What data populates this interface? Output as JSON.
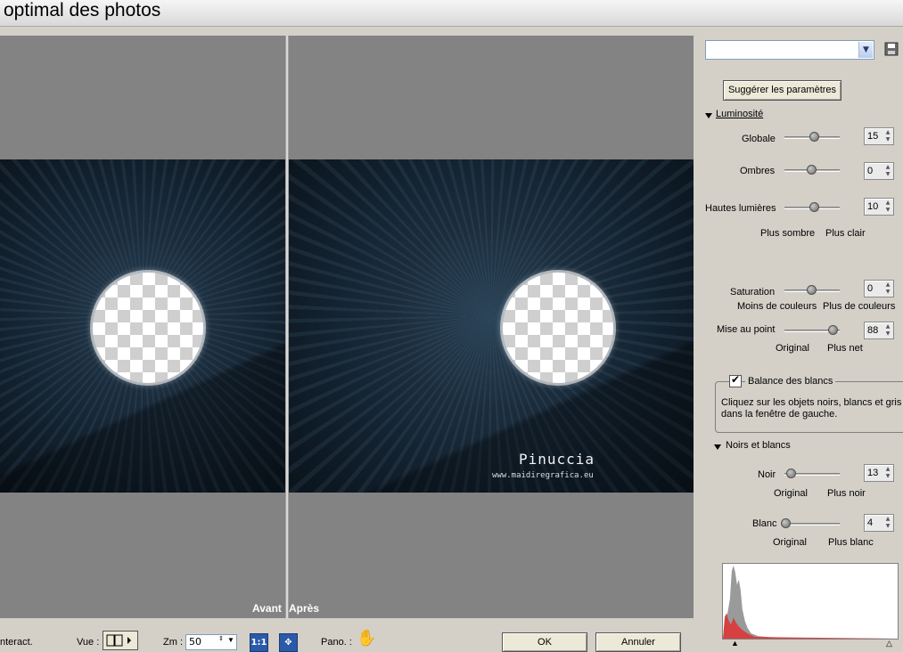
{
  "window": {
    "title": "optimal des photos"
  },
  "preview": {
    "before_label": "Avant",
    "after_label": "Après",
    "watermark_name": "Pinuccia",
    "watermark_url": "www.maidiregrafica.eu"
  },
  "panel": {
    "preset_value": "",
    "save_icon": "floppy-disk-icon",
    "suggest_label": "Suggérer les paramètres",
    "brightness": {
      "header": "Luminosité",
      "globale": {
        "label": "Globale",
        "value": "15",
        "level": 0.55
      },
      "ombres": {
        "label": "Ombres",
        "value": "0",
        "level": 0.5
      },
      "hautes": {
        "label": "Hautes lumières",
        "value": "10",
        "level": 0.55
      },
      "left_hint": "Plus sombre",
      "right_hint": "Plus clair"
    },
    "saturation": {
      "label": "Saturation",
      "value": "0",
      "level": 0.5,
      "left_hint": "Moins de couleurs",
      "right_hint": "Plus de couleurs"
    },
    "focus": {
      "label": "Mise au point",
      "value": "88",
      "level": 0.88,
      "left_hint": "Original",
      "right_hint": "Plus net"
    },
    "white_balance": {
      "label": "Balance des blancs",
      "checked": true,
      "instructions": "Cliquez sur les objets noirs, blancs et gris dans la fenêtre de gauche."
    },
    "blacks_whites": {
      "header": "Noirs et blancs",
      "noir": {
        "label": "Noir",
        "value": "13",
        "level": 0.13,
        "left_hint": "Original",
        "right_hint": "Plus noir"
      },
      "blanc": {
        "label": "Blanc",
        "value": "4",
        "level": 0.04,
        "left_hint": "Original",
        "right_hint": "Plus blanc"
      }
    }
  },
  "bottom": {
    "interact_label": "nteract.",
    "view_label": "Vue :",
    "zoom_label": "Zm :",
    "zoom_value": "50",
    "fit_label": "1:1",
    "pan_label": "Pano. :",
    "ok_label": "OK",
    "cancel_label": "Annuler"
  },
  "colors": {
    "preview_bg": "#838383",
    "panel_bg": "#d4d0c8",
    "histogram_gray": "#9a9a9a",
    "histogram_red": "#e03030"
  }
}
